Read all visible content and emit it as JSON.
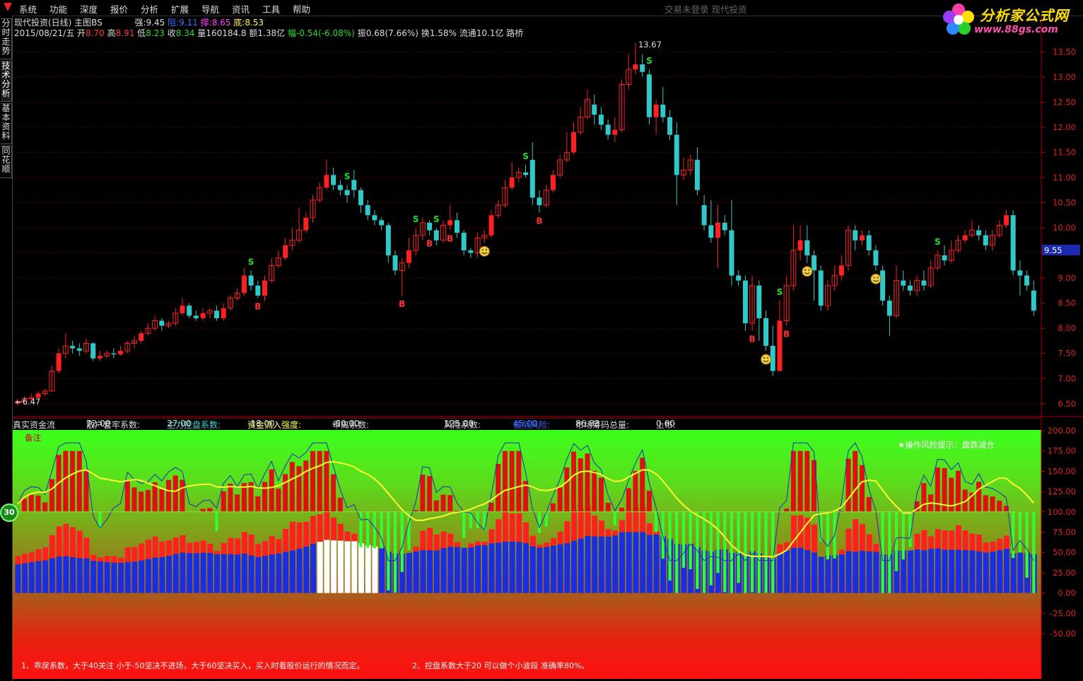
{
  "menu": {
    "items": [
      "系统",
      "功能",
      "深度",
      "报价",
      "分析",
      "扩展",
      "导航",
      "资讯",
      "工具",
      "帮助"
    ],
    "center_title": "交易未登录   现代投资"
  },
  "brand": {
    "name": "分析家公式网",
    "url": "www.88gs.com"
  },
  "left_tabs": [
    "分时走势",
    "技术分析",
    "基本资料",
    "同花顺"
  ],
  "header": {
    "title": "现代投资(日线) 主图BS",
    "strong_label": "强:",
    "strong_val": "9.45",
    "resist_label": "阻:",
    "resist_val": "9.11",
    "support_label": "撑:",
    "support_val": "8.65",
    "bottom_label": "底:",
    "bottom_val": "8.53",
    "date": "2015/08/21/五",
    "open_label": "开",
    "open": "8.70",
    "high_label": "高",
    "high": "8.91",
    "low_label": "低",
    "low": "8.23",
    "close_label": "收",
    "close": "8.34",
    "vol_label": "量",
    "vol": "160184.8",
    "amt_label": "额",
    "amt": "1.38亿",
    "chg_label": "幅",
    "chg": "-0.54(-6.08%)",
    "amp_label": "振",
    "amp": "0.68(7.66%)",
    "turn_label": "换",
    "turn": "1.58%",
    "float_label": "流通",
    "float": "10.1亿",
    "extra": "路桥"
  },
  "price_axis": {
    "labels": [
      "13.50",
      "13.00",
      "12.50",
      "12.00",
      "11.50",
      "11.00",
      "10.50",
      "10.00",
      "9.50",
      "9.00",
      "8.50",
      "8.00",
      "7.50",
      "7.00",
      "6.50"
    ],
    "current": "9.55",
    "max_mark": "13.67",
    "min_mark": "6.47"
  },
  "indicator": {
    "name": "真实资金流",
    "trap_label": "散户套牢系数:",
    "trap": "72.00",
    "control_label": "主力控盘系数:",
    "control": "27.00",
    "inflow_label": "资金流入强度:",
    "inflow": "-18.00",
    "dev_label": "乖离系数:",
    "dev": "-80.00",
    "risk_label": "风险系数:",
    "risk": "125.00",
    "drop_label": "被侧风险:",
    "drop": "45.00",
    "chip_label": "市场筹码总量:",
    "chip": "86.83",
    "up_label": "上市:",
    "up": "0.60",
    "note": "备注",
    "risk_tip": "★操作风险提示：盘跌减仓",
    "axis": [
      "200.00",
      "175.00",
      "150.00",
      "125.00",
      "100.00",
      "75.00",
      "50.00",
      "25.00",
      "0.00",
      "-25.00",
      "-50.00"
    ],
    "badge": "30"
  },
  "notes": {
    "n1": "1、乖戾系数，大于40关注 小于-50坚决不进场，大于60坚决买入，买入时看股价运行的情况而定。",
    "n2": "2、控盘系数大于20 可以做个小波段 准确率80%。"
  },
  "colors": {
    "up": "#ff2020",
    "down": "#30c8c8",
    "blue": "#1a2ee0",
    "yellow": "#ffff30"
  },
  "chart_data": {
    "type": "candlestick",
    "y_range": [
      6.3,
      13.8
    ],
    "candles": [
      [
        6.5,
        6.55,
        6.47,
        6.6
      ],
      [
        6.55,
        6.6,
        6.5,
        6.65
      ],
      [
        6.6,
        6.62,
        6.55,
        6.7
      ],
      [
        6.62,
        6.7,
        6.6,
        6.75
      ],
      [
        6.7,
        6.75,
        6.65,
        6.8
      ],
      [
        6.75,
        7.15,
        6.75,
        7.25
      ],
      [
        7.15,
        7.5,
        7.1,
        7.6
      ],
      [
        7.5,
        7.65,
        7.4,
        7.9
      ],
      [
        7.65,
        7.6,
        7.5,
        7.75
      ],
      [
        7.6,
        7.55,
        7.45,
        7.7
      ],
      [
        7.55,
        7.7,
        7.5,
        7.8
      ],
      [
        7.7,
        7.4,
        7.35,
        7.72
      ],
      [
        7.4,
        7.45,
        7.35,
        7.55
      ],
      [
        7.45,
        7.5,
        7.4,
        7.55
      ],
      [
        7.5,
        7.48,
        7.4,
        7.6
      ],
      [
        7.48,
        7.55,
        7.45,
        7.65
      ],
      [
        7.55,
        7.7,
        7.5,
        7.75
      ],
      [
        7.7,
        7.75,
        7.6,
        7.85
      ],
      [
        7.75,
        7.9,
        7.7,
        7.95
      ],
      [
        7.9,
        8.0,
        7.85,
        8.1
      ],
      [
        8.0,
        8.15,
        7.95,
        8.25
      ],
      [
        8.15,
        8.05,
        7.95,
        8.2
      ],
      [
        8.05,
        8.1,
        8.0,
        8.15
      ],
      [
        8.1,
        8.3,
        8.05,
        8.4
      ],
      [
        8.3,
        8.45,
        8.25,
        8.6
      ],
      [
        8.45,
        8.25,
        8.2,
        8.5
      ],
      [
        8.25,
        8.2,
        8.15,
        8.35
      ],
      [
        8.2,
        8.3,
        8.15,
        8.4
      ],
      [
        8.3,
        8.35,
        8.2,
        8.4
      ],
      [
        8.35,
        8.2,
        8.15,
        8.45
      ],
      [
        8.2,
        8.4,
        8.15,
        8.5
      ],
      [
        8.4,
        8.6,
        8.35,
        8.65
      ],
      [
        8.6,
        8.7,
        8.55,
        8.8
      ],
      [
        8.7,
        9.05,
        8.65,
        9.2
      ],
      [
        9.05,
        8.85,
        8.75,
        9.15
      ],
      [
        8.85,
        8.65,
        8.6,
        8.95
      ],
      [
        8.65,
        8.95,
        8.55,
        9.05
      ],
      [
        8.95,
        9.25,
        8.9,
        9.4
      ],
      [
        9.25,
        9.4,
        9.2,
        9.55
      ],
      [
        9.4,
        9.65,
        9.35,
        9.8
      ],
      [
        9.65,
        9.75,
        9.55,
        10.0
      ],
      [
        9.75,
        9.95,
        9.7,
        10.4
      ],
      [
        9.95,
        10.2,
        9.9,
        10.3
      ],
      [
        10.2,
        10.55,
        10.1,
        10.65
      ],
      [
        10.55,
        10.8,
        10.5,
        10.9
      ],
      [
        10.8,
        11.05,
        10.75,
        11.35
      ],
      [
        11.05,
        10.85,
        10.75,
        11.2
      ],
      [
        10.85,
        10.75,
        10.65,
        10.95
      ],
      [
        10.75,
        10.65,
        10.5,
        10.85
      ],
      [
        10.95,
        10.75,
        10.6,
        11.15
      ],
      [
        10.75,
        10.45,
        10.3,
        10.8
      ],
      [
        10.45,
        10.25,
        10.15,
        10.55
      ],
      [
        10.25,
        10.15,
        10.05,
        10.35
      ],
      [
        10.15,
        10.05,
        9.95,
        10.2
      ],
      [
        10.05,
        9.45,
        9.3,
        10.1
      ],
      [
        9.45,
        9.15,
        9.05,
        9.55
      ],
      [
        9.15,
        9.3,
        8.65,
        9.4
      ],
      [
        9.3,
        9.55,
        9.2,
        9.8
      ],
      [
        9.55,
        9.85,
        9.45,
        10.0
      ],
      [
        9.85,
        10.1,
        9.75,
        10.2
      ],
      [
        10.1,
        9.95,
        9.85,
        10.15
      ],
      [
        9.95,
        9.75,
        9.65,
        10.0
      ],
      [
        9.75,
        10.05,
        9.7,
        10.15
      ],
      [
        10.05,
        10.15,
        9.95,
        10.45
      ],
      [
        10.15,
        9.9,
        9.8,
        10.3
      ],
      [
        9.9,
        9.55,
        9.45,
        9.95
      ],
      [
        9.55,
        9.5,
        9.4,
        9.6
      ],
      [
        9.5,
        9.8,
        9.4,
        9.9
      ],
      [
        9.8,
        9.85,
        9.7,
        9.95
      ],
      [
        9.85,
        10.25,
        9.8,
        10.35
      ],
      [
        10.25,
        10.45,
        10.2,
        10.55
      ],
      [
        10.45,
        10.8,
        10.4,
        10.95
      ],
      [
        10.8,
        11.0,
        10.75,
        11.3
      ],
      [
        11.0,
        11.1,
        10.9,
        11.2
      ],
      [
        11.1,
        11.05,
        11.0,
        11.25
      ],
      [
        11.35,
        10.6,
        10.45,
        11.7
      ],
      [
        10.6,
        10.45,
        10.3,
        10.75
      ],
      [
        10.45,
        10.75,
        10.4,
        10.85
      ],
      [
        10.75,
        11.05,
        10.7,
        11.15
      ],
      [
        11.05,
        11.35,
        11.0,
        11.45
      ],
      [
        11.35,
        11.5,
        11.3,
        11.9
      ],
      [
        11.5,
        11.9,
        11.45,
        12.1
      ],
      [
        11.9,
        12.2,
        11.85,
        12.4
      ],
      [
        12.2,
        12.55,
        12.15,
        12.75
      ],
      [
        12.45,
        12.25,
        12.05,
        12.65
      ],
      [
        12.25,
        12.05,
        11.95,
        12.4
      ],
      [
        12.05,
        11.85,
        11.75,
        12.15
      ],
      [
        11.85,
        11.95,
        11.7,
        12.2
      ],
      [
        11.95,
        12.85,
        11.9,
        12.95
      ],
      [
        12.85,
        13.15,
        12.75,
        13.45
      ],
      [
        13.15,
        13.25,
        13.05,
        13.67
      ],
      [
        13.25,
        13.1,
        13.0,
        13.45
      ],
      [
        13.05,
        12.2,
        12.05,
        13.15
      ],
      [
        12.2,
        12.45,
        11.85,
        12.55
      ],
      [
        12.45,
        12.2,
        12.1,
        12.8
      ],
      [
        12.2,
        11.85,
        11.75,
        12.35
      ],
      [
        11.85,
        11.05,
        10.45,
        12.1
      ],
      [
        11.05,
        11.15,
        10.95,
        11.4
      ],
      [
        11.15,
        11.35,
        11.05,
        11.45
      ],
      [
        11.35,
        10.75,
        10.65,
        11.6
      ],
      [
        10.45,
        10.05,
        9.95,
        10.65
      ],
      [
        10.05,
        9.8,
        9.7,
        10.55
      ],
      [
        9.8,
        10.1,
        9.2,
        10.45
      ],
      [
        10.1,
        9.95,
        9.85,
        10.25
      ],
      [
        9.95,
        9.05,
        8.85,
        10.55
      ],
      [
        9.05,
        8.95,
        8.85,
        9.15
      ],
      [
        8.95,
        8.1,
        7.95,
        9.05
      ],
      [
        8.1,
        8.85,
        7.95,
        9.05
      ],
      [
        8.85,
        8.2,
        7.75,
        8.95
      ],
      [
        8.2,
        7.65,
        7.55,
        8.35
      ],
      [
        7.65,
        7.15,
        7.05,
        8.05
      ],
      [
        7.15,
        8.15,
        7.35,
        8.55
      ],
      [
        8.15,
        8.85,
        8.05,
        9.05
      ],
      [
        8.85,
        9.55,
        8.75,
        10.05
      ],
      [
        9.55,
        9.75,
        9.35,
        10.05
      ],
      [
        9.75,
        9.45,
        9.3,
        10.05
      ],
      [
        9.45,
        9.15,
        8.55,
        9.55
      ],
      [
        9.15,
        8.45,
        8.35,
        9.25
      ],
      [
        8.45,
        8.85,
        8.35,
        8.95
      ],
      [
        8.85,
        9.05,
        8.75,
        9.25
      ],
      [
        9.05,
        9.25,
        8.95,
        9.45
      ],
      [
        9.25,
        9.95,
        9.15,
        10.05
      ],
      [
        9.95,
        9.75,
        9.55,
        10.05
      ],
      [
        9.75,
        9.85,
        9.65,
        9.95
      ],
      [
        9.85,
        9.55,
        9.45,
        9.95
      ],
      [
        9.55,
        9.25,
        9.15,
        9.65
      ],
      [
        9.15,
        8.55,
        8.45,
        9.25
      ],
      [
        8.55,
        8.25,
        7.85,
        8.65
      ],
      [
        8.25,
        8.95,
        8.2,
        9.25
      ],
      [
        8.95,
        8.85,
        8.75,
        9.15
      ],
      [
        8.85,
        8.75,
        8.65,
        8.95
      ],
      [
        8.75,
        8.95,
        8.65,
        9.05
      ],
      [
        8.95,
        8.85,
        8.75,
        9.15
      ],
      [
        8.85,
        9.2,
        8.8,
        9.35
      ],
      [
        9.2,
        9.45,
        9.15,
        9.55
      ],
      [
        9.45,
        9.35,
        9.25,
        9.65
      ],
      [
        9.35,
        9.55,
        9.3,
        9.75
      ],
      [
        9.55,
        9.75,
        9.5,
        9.85
      ],
      [
        9.75,
        9.85,
        9.7,
        9.95
      ],
      [
        9.85,
        9.95,
        9.8,
        10.15
      ],
      [
        9.95,
        9.85,
        9.75,
        10.05
      ],
      [
        9.85,
        9.65,
        9.55,
        9.95
      ],
      [
        9.65,
        9.85,
        9.55,
        9.95
      ],
      [
        9.85,
        10.05,
        9.8,
        10.15
      ],
      [
        10.05,
        10.25,
        10.0,
        10.35
      ],
      [
        10.25,
        9.15,
        9.05,
        10.35
      ],
      [
        9.15,
        9.05,
        8.65,
        9.35
      ],
      [
        9.05,
        8.85,
        8.75,
        9.15
      ],
      [
        8.75,
        8.35,
        8.25,
        8.95
      ]
    ],
    "signals": [
      {
        "i": 34,
        "t": "S"
      },
      {
        "i": 35,
        "t": "B"
      },
      {
        "i": 48,
        "t": "S"
      },
      {
        "i": 56,
        "t": "B"
      },
      {
        "i": 58,
        "t": "S"
      },
      {
        "i": 60,
        "t": "B"
      },
      {
        "i": 61,
        "t": "S"
      },
      {
        "i": 63,
        "t": "B"
      },
      {
        "i": 68,
        "t": "smile"
      },
      {
        "i": 74,
        "t": "S"
      },
      {
        "i": 76,
        "t": "B"
      },
      {
        "i": 92,
        "t": "S"
      },
      {
        "i": 107,
        "t": "B"
      },
      {
        "i": 109,
        "t": "smile"
      },
      {
        "i": 111,
        "t": "S"
      },
      {
        "i": 112,
        "t": "B"
      },
      {
        "i": 115,
        "t": "smile"
      },
      {
        "i": 125,
        "t": "smile"
      },
      {
        "i": 134,
        "t": "S"
      }
    ]
  }
}
